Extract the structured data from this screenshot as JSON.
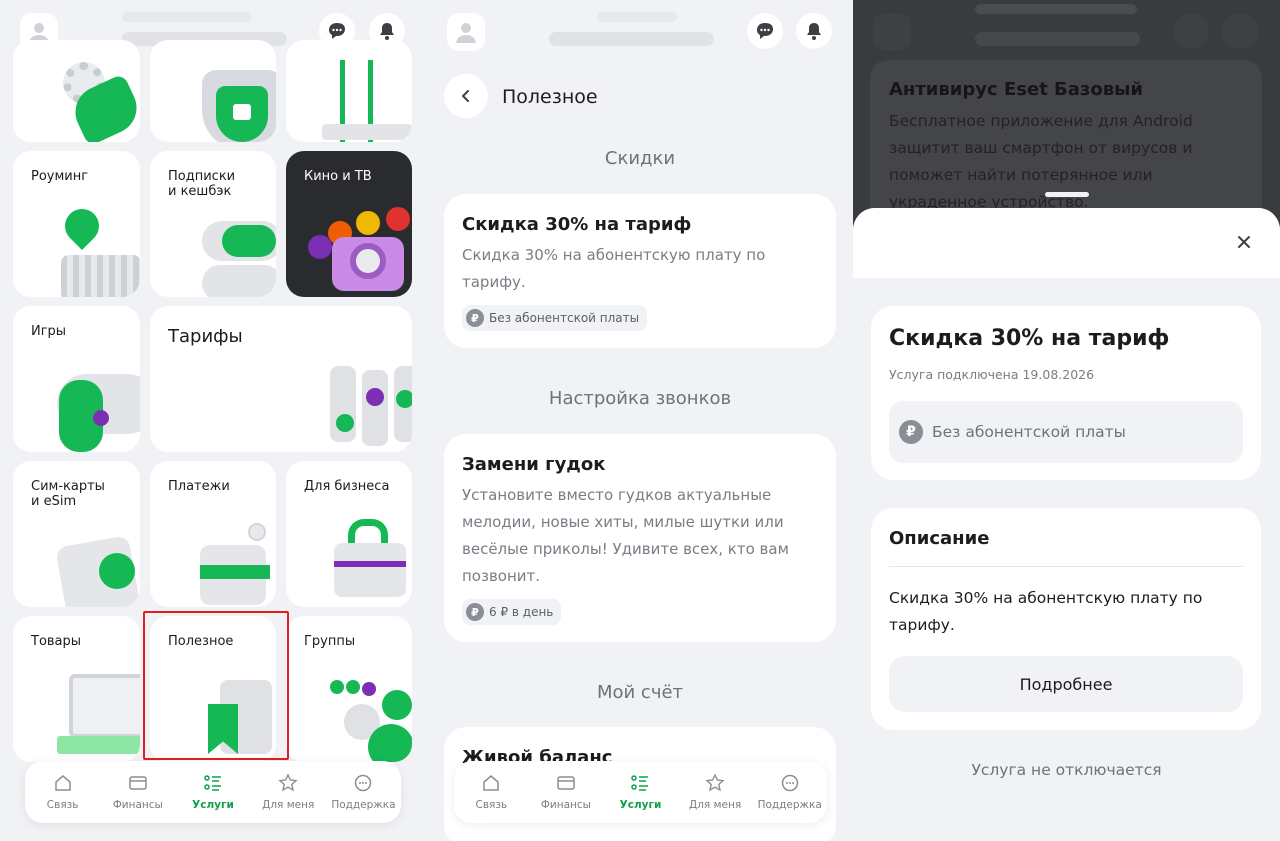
{
  "colors": {
    "accent": "#0fa14b",
    "purple": "#7a2fb5",
    "highlight": "#e02020"
  },
  "services_screen": {
    "tiles": [
      {
        "label": ""
      },
      {
        "label": ""
      },
      {
        "label": ""
      },
      {
        "label": "Роуминг"
      },
      {
        "label": "Подписки\nи кешбэк"
      },
      {
        "label": "Кино и ТВ"
      },
      {
        "label": "Игры"
      },
      {
        "label": "Тарифы"
      },
      {
        "label": "Сим-карты\nи eSim"
      },
      {
        "label": "Платежи"
      },
      {
        "label": "Для бизнеса"
      },
      {
        "label": "Товары"
      },
      {
        "label": "Полезное"
      },
      {
        "label": "Группы"
      }
    ]
  },
  "nav": {
    "items": [
      {
        "label": "Связь",
        "icon": "home-icon"
      },
      {
        "label": "Финансы",
        "icon": "card-icon"
      },
      {
        "label": "Услуги",
        "icon": "services-icon"
      },
      {
        "label": "Для меня",
        "icon": "star-icon"
      },
      {
        "label": "Поддержка",
        "icon": "chat-icon"
      }
    ]
  },
  "useful_screen": {
    "title": "Полезное",
    "sections": [
      {
        "heading": "Скидки",
        "card": {
          "title": "Скидка 30% на тариф",
          "desc": "Скидка 30% на абонентскую плату по тарифу.",
          "chip": "Без абонентской платы"
        }
      },
      {
        "heading": "Настройка звонков",
        "card": {
          "title": "Замени гудок",
          "desc": "Установите вместо гудков актуальные мелодии, новые хиты, милые шутки или весёлые приколы! Удивите всех, кто вам позвонит.",
          "chip": "6 ₽ в день"
        }
      },
      {
        "heading": "Мой счёт",
        "card": {
          "title": "Живой баланс"
        }
      }
    ]
  },
  "detail_screen": {
    "bg_title": "Антивирус Eset Базовый",
    "bg_desc": "Бесплатное приложение для Android защитит ваш смартфон от вирусов и поможет найти потерянное или украденное устройство.",
    "title": "Скидка 30% на тариф",
    "subtitle": "Услуга подключена 19.08.2026",
    "fee": "Без абонентской платы",
    "desc_heading": "Описание",
    "desc": "Скидка 30% на абонентскую плату по тарифу.",
    "more_button": "Подробнее",
    "footer_note": "Услуга не отключается"
  }
}
